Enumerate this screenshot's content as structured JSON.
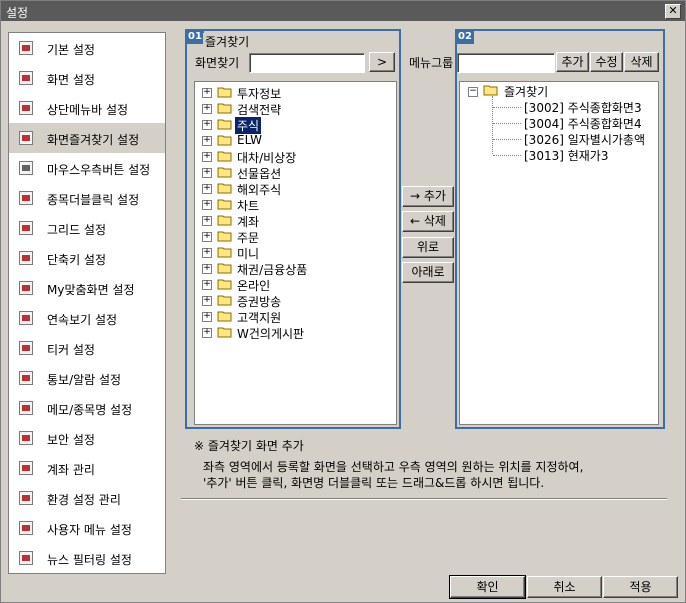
{
  "window": {
    "title": "설정",
    "close_glyph": "✕"
  },
  "sidebar": {
    "items": [
      {
        "label": "기본 설정",
        "icon": "basic-settings-icon"
      },
      {
        "label": "화면 설정",
        "icon": "screen-settings-icon"
      },
      {
        "label": "상단메뉴바 설정",
        "icon": "top-menu-icon"
      },
      {
        "label": "화면즐겨찾기 설정",
        "icon": "star-icon"
      },
      {
        "label": "마우스우측버튼 설정",
        "icon": "mouse-icon"
      },
      {
        "label": "종목더블클릭 설정",
        "icon": "double-click-icon"
      },
      {
        "label": "그리드 설정",
        "icon": "grid-icon"
      },
      {
        "label": "단축키 설정",
        "icon": "shortcut-icon"
      },
      {
        "label": "My맞춤화면 설정",
        "icon": "my-screen-icon"
      },
      {
        "label": "연속보기 설정",
        "icon": "continuous-view-icon"
      },
      {
        "label": "티커 설정",
        "icon": "ticker-icon"
      },
      {
        "label": "통보/알람 설정",
        "icon": "alarm-icon"
      },
      {
        "label": "메모/종목명 설정",
        "icon": "memo-icon"
      },
      {
        "label": "보안 설정",
        "icon": "shield-icon"
      },
      {
        "label": "계좌 관리",
        "icon": "account-icon"
      },
      {
        "label": "환경 설정 관리",
        "icon": "gear-icon"
      },
      {
        "label": "사용자 메뉴 설정",
        "icon": "user-menu-icon"
      },
      {
        "label": "뉴스 필터링 설정",
        "icon": "news-filter-icon"
      }
    ],
    "active_index": 3
  },
  "left_panel": {
    "badge": "01",
    "group_label": "즐겨찾기",
    "search_label": "화면찾기",
    "search_value": "",
    "search_button": ">",
    "tree": [
      {
        "label": "투자정보"
      },
      {
        "label": "검색전략"
      },
      {
        "label": "주식",
        "selected": true
      },
      {
        "label": "ELW"
      },
      {
        "label": "대차/비상장"
      },
      {
        "label": "선물옵션"
      },
      {
        "label": "해외주식"
      },
      {
        "label": "차트"
      },
      {
        "label": "계좌"
      },
      {
        "label": "주문"
      },
      {
        "label": "미니"
      },
      {
        "label": "채권/금융상품"
      },
      {
        "label": "온라인"
      },
      {
        "label": "증권방송"
      },
      {
        "label": "고객지원"
      },
      {
        "label": "W건의게시판"
      }
    ]
  },
  "middle_buttons": {
    "add": "→ 추가",
    "delete": "← 삭제",
    "up": "위로",
    "down": "아래로"
  },
  "right_panel": {
    "badge": "02",
    "menu_group_label": "메뉴그룹",
    "menu_group_value": "",
    "add_button": "추가",
    "edit_button": "수정",
    "delete_button": "삭제",
    "root_label": "즐겨찾기",
    "root_toggle": "−",
    "items": [
      {
        "label": "[3002] 주식종합화면3"
      },
      {
        "label": "[3004] 주식종합화면4"
      },
      {
        "label": "[3026] 일자별시가총액"
      },
      {
        "label": "[3013] 현재가3"
      }
    ]
  },
  "notes": {
    "heading": "※ 즐겨찾기 화면 추가",
    "line1": "좌측 영역에서 등록할 화면을 선택하고 우측 영역의 원하는 위치를 지정하여,",
    "line2": "'추가' 버튼 클릭, 화면명 더블클릭 또는 드래그&드롭 하시면 됩니다."
  },
  "footer": {
    "ok": "확인",
    "cancel": "취소",
    "apply": "적용"
  },
  "colors": {
    "accent": "#3a6ea5",
    "selection": "#0a246a"
  }
}
